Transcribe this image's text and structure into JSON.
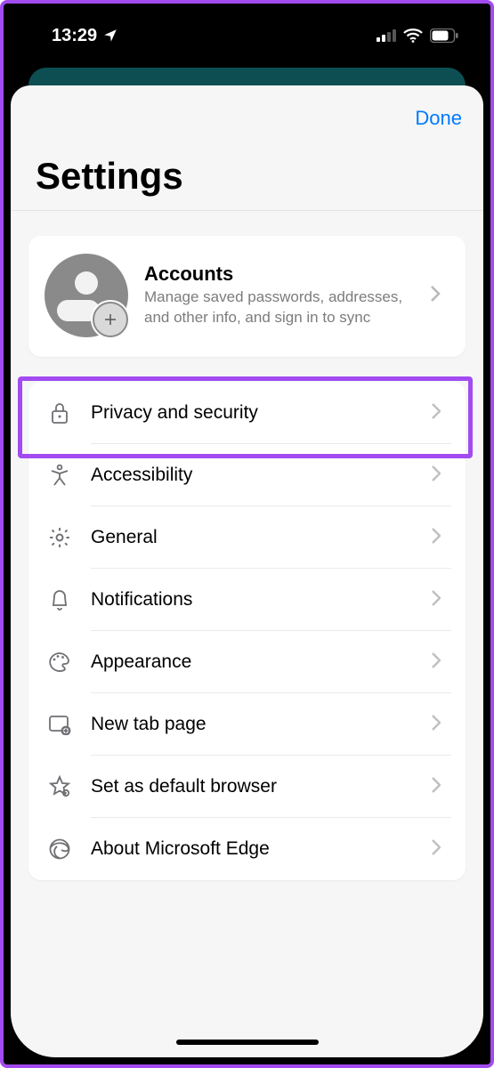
{
  "status": {
    "time": "13:29"
  },
  "sheet": {
    "done_label": "Done",
    "title": "Settings"
  },
  "accounts": {
    "title": "Accounts",
    "subtitle": "Manage saved passwords, addresses, and other info, and sign in to sync"
  },
  "rows": {
    "privacy": "Privacy and security",
    "accessibility": "Accessibility",
    "general": "General",
    "notifications": "Notifications",
    "appearance": "Appearance",
    "newtab": "New tab page",
    "default": "Set as default browser",
    "about": "About Microsoft Edge"
  }
}
